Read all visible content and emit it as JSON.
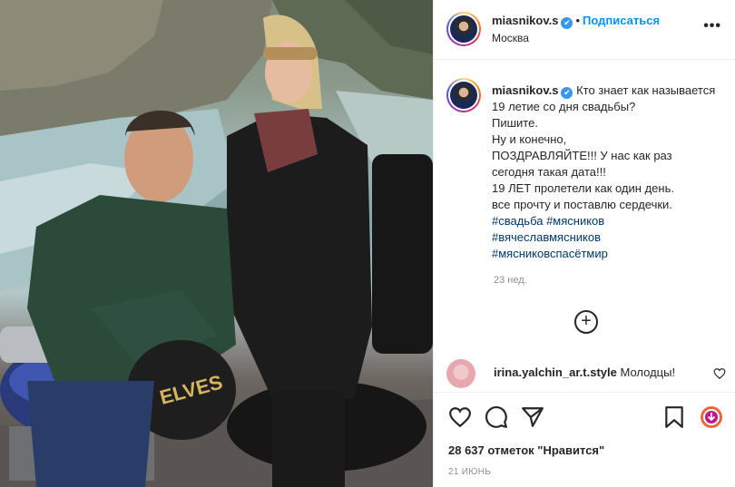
{
  "post": {
    "username": "miasnikov.s",
    "verified_mark": "✔",
    "separator": "•",
    "follow_label": "Подписаться",
    "location": "Москва",
    "more_label": "•••"
  },
  "caption": {
    "username": "miasnikov.s",
    "lines": [
      "Кто знает как называется",
      "19 летие со дня свадьбы?",
      "Пишите.",
      "Ну и конечно,",
      "ПОЗДРАВЛЯЙТЕ!!! У нас как раз",
      "сегодня такая дата!!!",
      "19 ЛЕТ пролетели как один день.",
      "все прочту и поставлю сердечки."
    ],
    "hashtags": [
      "#свадьба #мясников",
      "#вячеславмясников",
      "#мясниковспасётмир"
    ],
    "time": "23 нед."
  },
  "load_more_icon": "plus-circle-icon",
  "comment": {
    "username": "irina.yalchin_ar.t.style",
    "text": "Молодцы!"
  },
  "actions": {
    "icons": [
      "heart-icon",
      "comment-icon",
      "share-icon",
      "bookmark-icon",
      "story-badge-icon"
    ],
    "likes_text": "28 637 отметок \"Нравится\"",
    "date": "21 ИЮНЬ"
  },
  "photo": {
    "helmet_text": "ELVES"
  },
  "colors": {
    "link": "#0095f6",
    "hashtag": "#00376b",
    "muted": "#8e8e8e",
    "border": "#efefef"
  }
}
